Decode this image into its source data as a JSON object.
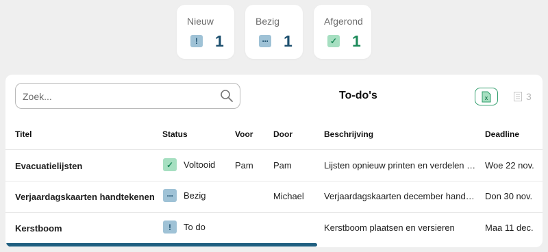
{
  "stats": [
    {
      "label": "Nieuw",
      "icon": "!",
      "count": "1",
      "color": "#1c4f6e"
    },
    {
      "label": "Bezig",
      "icon": "···",
      "count": "1",
      "color": "#1c4f6e"
    },
    {
      "label": "Afgerond",
      "icon": "✓",
      "count": "1",
      "color": "#1c8a5a"
    }
  ],
  "search": {
    "placeholder": "Zoek..."
  },
  "title": "To-do's",
  "row_count": "3",
  "columns": [
    "Titel",
    "Status",
    "Voor",
    "Door",
    "Beschrijving",
    "Deadline"
  ],
  "rows": [
    {
      "title": "Evacuatielijsten",
      "status": "Voltooid",
      "status_icon": "✓",
      "voor": "Pam",
      "door": "Pam",
      "beschrijving": "Lijsten opnieuw printen en verdelen …",
      "deadline": "Woe 22 nov."
    },
    {
      "title": "Verjaardagskaarten handtekenen",
      "status": "Bezig",
      "status_icon": "···",
      "voor": "",
      "door": "Michael",
      "beschrijving": "Verjaardagskaarten december hand…",
      "deadline": "Don 30 nov."
    },
    {
      "title": "Kerstboom",
      "status": "To do",
      "status_icon": "!",
      "voor": "",
      "door": "",
      "beschrijving": "Kerstboom plaatsen en versieren",
      "deadline": "Maa 11 dec."
    }
  ]
}
